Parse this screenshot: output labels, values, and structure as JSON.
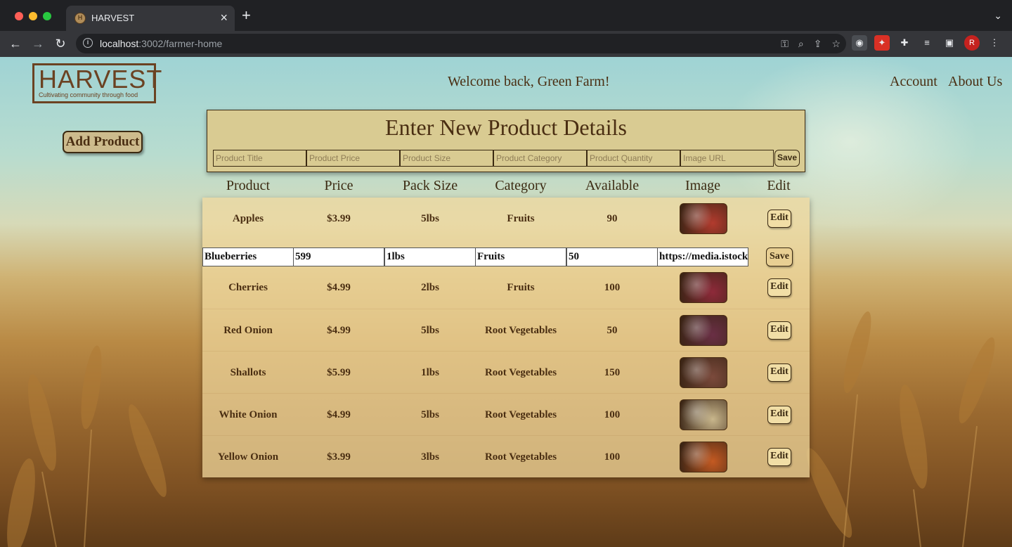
{
  "browser": {
    "tab_title": "HARVEST",
    "favicon_letter": "H",
    "url_host": "localhost",
    "url_rest": ":3002/farmer-home"
  },
  "header": {
    "logo_main": "HARVEST",
    "logo_tagline": "Cultivating community through food",
    "welcome": "Welcome back, Green Farm!",
    "nav": [
      "Account",
      "About Us"
    ]
  },
  "add_product_label": "Add Product",
  "new_product": {
    "title": "Enter New Product Details",
    "placeholders": [
      "Product Title",
      "Product Price",
      "Product Size",
      "Product Category",
      "Product Quantity",
      "Image URL"
    ],
    "save_label": "Save"
  },
  "table": {
    "headers": [
      "Product",
      "Price",
      "Pack Size",
      "Category",
      "Available",
      "Image",
      "Edit"
    ],
    "edit_label": "Edit",
    "rows": [
      {
        "product": "Apples",
        "price": "$3.99",
        "size": "5lbs",
        "category": "Fruits",
        "available": "90",
        "image_color": "#b23b2e"
      },
      {
        "product": "Cherries",
        "price": "$4.99",
        "size": "2lbs",
        "category": "Fruits",
        "available": "100",
        "image_color": "#8e2a3a"
      },
      {
        "product": "Red Onion",
        "price": "$4.99",
        "size": "5lbs",
        "category": "Root Vegetables",
        "available": "50",
        "image_color": "#6a2f45"
      },
      {
        "product": "Shallots",
        "price": "$5.99",
        "size": "1lbs",
        "category": "Root Vegetables",
        "available": "150",
        "image_color": "#7b4a3c"
      },
      {
        "product": "White Onion",
        "price": "$4.99",
        "size": "5lbs",
        "category": "Root Vegetables",
        "available": "100",
        "image_color": "#c9b78c"
      },
      {
        "product": "Yellow Onion",
        "price": "$3.99",
        "size": "3lbs",
        "category": "Root Vegetables",
        "available": "100",
        "image_color": "#c45a22"
      }
    ],
    "editing_row": {
      "values": [
        "Blueberries",
        "599",
        "1lbs",
        "Fruits",
        "50",
        "https://media.istockp"
      ],
      "save_label": "Save"
    }
  },
  "colors": {
    "accent_brown": "#4a2e12",
    "panel_tan": "#d9cb92"
  }
}
